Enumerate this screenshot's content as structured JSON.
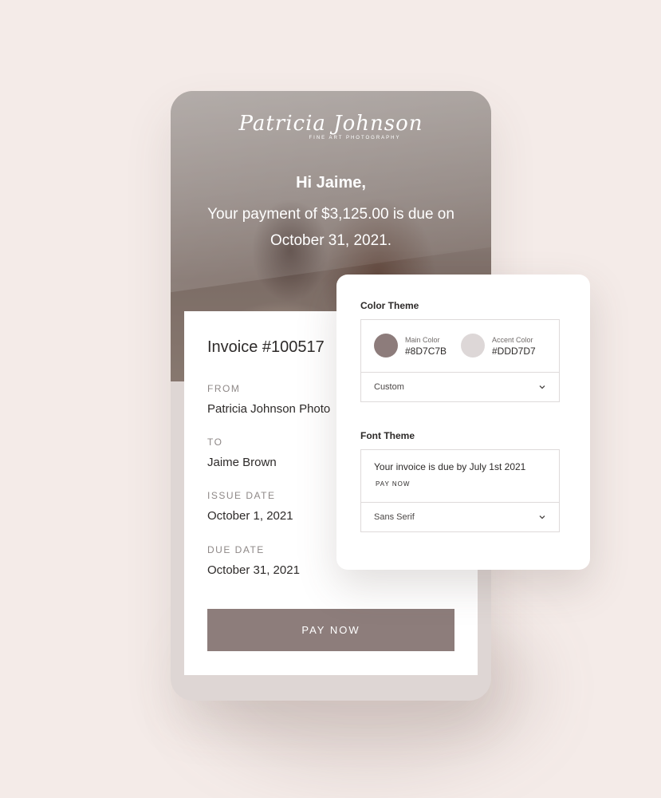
{
  "brand": {
    "name": "Patricia Johnson",
    "tagline": "FINE ART PHOTOGRAPHY"
  },
  "hero": {
    "greeting": "Hi Jaime,",
    "message": "Your payment of $3,125.00 is due on October 31, 2021."
  },
  "invoice": {
    "title": "Invoice #100517",
    "fields": [
      {
        "label": "FROM",
        "value": "Patricia Johnson Photo"
      },
      {
        "label": "TO",
        "value": "Jaime Brown"
      },
      {
        "label": "ISSUE DATE",
        "value": "October 1, 2021"
      },
      {
        "label": "DUE DATE",
        "value": "October 31, 2021"
      }
    ],
    "pay_label": "PAY NOW"
  },
  "color_theme": {
    "heading": "Color Theme",
    "main": {
      "label": "Main Color",
      "hex": "#8D7C7B",
      "color": "#8d7c7b"
    },
    "accent": {
      "label": "Accent Color",
      "hex": "#DDD7D7",
      "color": "#ddd7d7"
    },
    "selected": "Custom"
  },
  "font_theme": {
    "heading": "Font Theme",
    "preview_text": "Your invoice is due by July 1st 2021",
    "preview_button": "PAY NOW",
    "selected": "Sans Serif"
  },
  "icons": {
    "chevron": "chevron-down-icon"
  },
  "colors": {
    "background": "#f4ebe8",
    "button": "#8d7d7b",
    "phone_frame": "#ded6d4"
  }
}
